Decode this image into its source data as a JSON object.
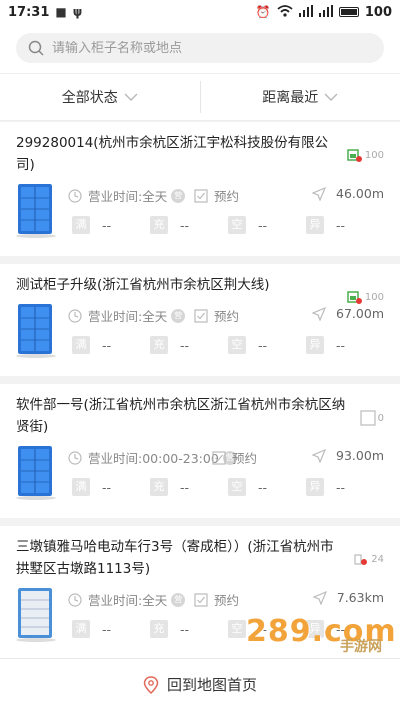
{
  "status_bar": {
    "time": "17:31",
    "battery": "100"
  },
  "search": {
    "placeholder": "请输入柜子名称或地点"
  },
  "filters": [
    {
      "label": "全部状态"
    },
    {
      "label": "距离最近"
    }
  ],
  "cards": [
    {
      "title": "299280014(杭州市余杭区浙江宇松科技股份有限公司)",
      "hours": "营业时间:全天",
      "booking": "预约",
      "distance": "46.00m",
      "badge": "100",
      "cabinet_color": "blue",
      "stats": {
        "full": "满",
        "full_val": "--",
        "charge": "充",
        "charge_val": "--",
        "empty": "空",
        "empty_val": "--",
        "abnormal": "异",
        "abnormal_val": "--"
      }
    },
    {
      "title": "测试柜子升级(浙江省杭州市余杭区荆大线)",
      "hours": "营业时间:全天",
      "booking": "预约",
      "distance": "67.00m",
      "badge": "100",
      "cabinet_color": "blue",
      "stats": {
        "full": "满",
        "full_val": "--",
        "charge": "充",
        "charge_val": "--",
        "empty": "空",
        "empty_val": "--",
        "abnormal": "异",
        "abnormal_val": "--"
      }
    },
    {
      "title": "软件部一号(浙江省杭州市余杭区浙江省杭州市余杭区纳贤街)",
      "hours": "营业时间:00:00-23:00",
      "booking": "预约",
      "distance": "93.00m",
      "badge": "0",
      "cabinet_color": "blue",
      "stats": {
        "full": "满",
        "full_val": "--",
        "charge": "充",
        "charge_val": "--",
        "empty": "空",
        "empty_val": "--",
        "abnormal": "异",
        "abnormal_val": "--"
      }
    },
    {
      "title": "三墩镇雅马哈电动车行3号（寄成柜））(浙江省杭州市拱墅区古墩路1113号)",
      "hours": "营业时间:全天",
      "booking": "预约",
      "distance": "7.63km",
      "badge": "24",
      "cabinet_color": "lightblue",
      "stats": {
        "full": "满",
        "full_val": "--",
        "charge": "充",
        "charge_val": "--",
        "empty": "空",
        "empty_val": "--",
        "abnormal": "异",
        "abnormal_val": "--"
      }
    }
  ],
  "bottom": {
    "label": "回到地图首页"
  },
  "watermark": {
    "text": "手游网",
    "big": "289.com"
  },
  "colors": {
    "accent": "#2a8df0",
    "chip": "#e4e4e4",
    "muted": "#888888"
  }
}
